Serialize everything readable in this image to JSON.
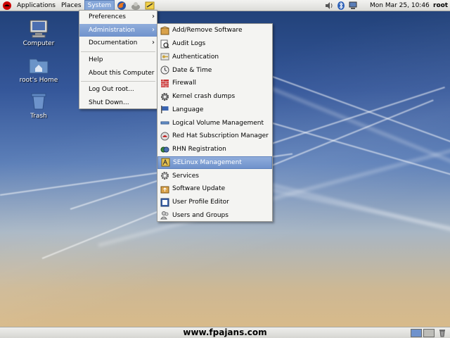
{
  "top_panel": {
    "applications": "Applications",
    "places": "Places",
    "system": "System",
    "clock": "Mon Mar 25, 10:46",
    "user": "root",
    "launchers": [
      "firefox-icon",
      "email-icon",
      "notes-icon"
    ],
    "tray": [
      "volume-icon",
      "bluetooth-icon",
      "network-icon"
    ]
  },
  "desktop": {
    "icons": [
      {
        "label": "Computer",
        "icon": "computer-icon"
      },
      {
        "label": "root's Home",
        "icon": "home-folder-icon"
      },
      {
        "label": "Trash",
        "icon": "trash-icon"
      }
    ]
  },
  "system_menu": {
    "items": [
      {
        "label": "Preferences",
        "submenu": true
      },
      {
        "label": "Administration",
        "submenu": true,
        "selected": true
      },
      {
        "label": "Documentation",
        "submenu": true
      },
      {
        "label": "Help"
      },
      {
        "label": "About this Computer"
      },
      {
        "label": "Log Out root..."
      },
      {
        "label": "Shut Down..."
      }
    ]
  },
  "admin_menu": {
    "items": [
      {
        "label": "Add/Remove Software",
        "icon": "package-icon"
      },
      {
        "label": "Audit Logs",
        "icon": "magnifier-icon"
      },
      {
        "label": "Authentication",
        "icon": "keys-icon"
      },
      {
        "label": "Date & Time",
        "icon": "clock-icon"
      },
      {
        "label": "Firewall",
        "icon": "firewall-icon"
      },
      {
        "label": "Kernel crash dumps",
        "icon": "gear-icon"
      },
      {
        "label": "Language",
        "icon": "flag-icon"
      },
      {
        "label": "Logical Volume Management",
        "icon": "disk-icon"
      },
      {
        "label": "Red Hat Subscription Manager",
        "icon": "redhat-icon"
      },
      {
        "label": "RHN Registration",
        "icon": "network-icon"
      },
      {
        "label": "SELinux Management",
        "icon": "selinux-icon",
        "selected": true
      },
      {
        "label": "Services",
        "icon": "services-icon"
      },
      {
        "label": "Software Update",
        "icon": "update-icon"
      },
      {
        "label": "User Profile Editor",
        "icon": "profile-icon"
      },
      {
        "label": "Users and Groups",
        "icon": "users-icon"
      }
    ]
  },
  "bottom_panel": {
    "watermark": "www.fpajans.com"
  },
  "colors": {
    "selection": "#7b9bd0",
    "panel": "#e4e4e0"
  }
}
